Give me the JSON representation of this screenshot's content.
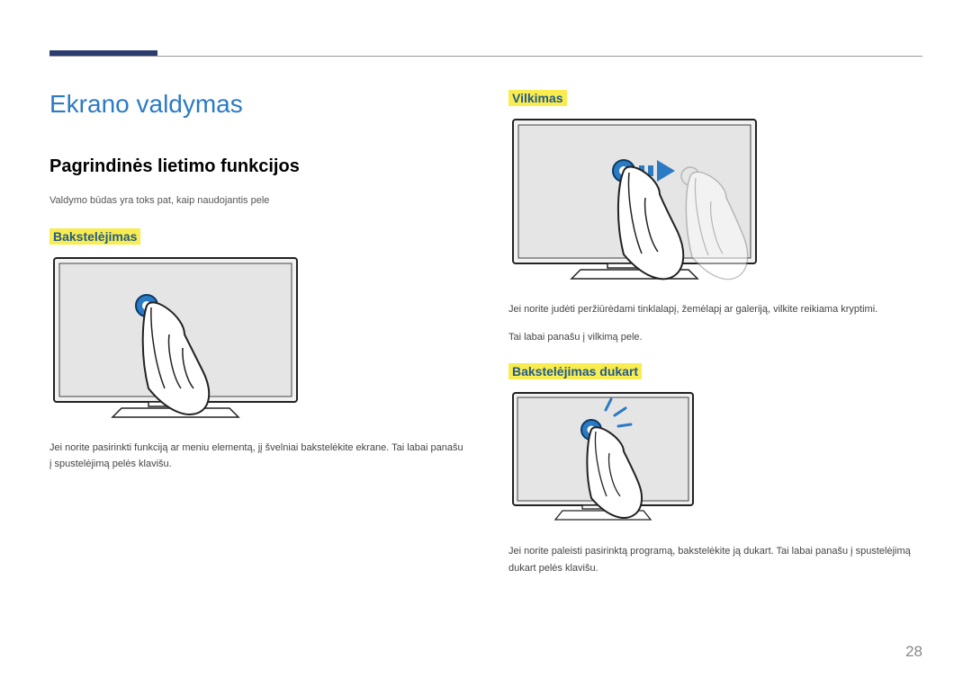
{
  "page_number": "28",
  "title": "Ekrano valdymas",
  "section_heading": "Pagrindinės lietimo funkcijos",
  "intro": "Valdymo būdas yra toks pat, kaip naudojantis pele",
  "tap": {
    "heading": "Bakstelėjimas",
    "desc": "Jei norite pasirinkti funkciją ar meniu elementą, jį švelniai bakstelėkite ekrane. Tai labai panašu į spustelėjimą pelės klavišu."
  },
  "drag": {
    "heading": "Vilkimas",
    "desc1": "Jei norite judėti peržiūrėdami tinklalapį, žemėlapį ar galeriją, vilkite reikiama kryptimi.",
    "desc2": "Tai labai panašu į vilkimą pele."
  },
  "dbltap": {
    "heading": "Bakstelėjimas dukart",
    "desc": "Jei norite paleisti pasirinktą programą, bakstelėkite ją dukart. Tai labai panašu į spustelėjimą dukart pelės klavišu."
  }
}
